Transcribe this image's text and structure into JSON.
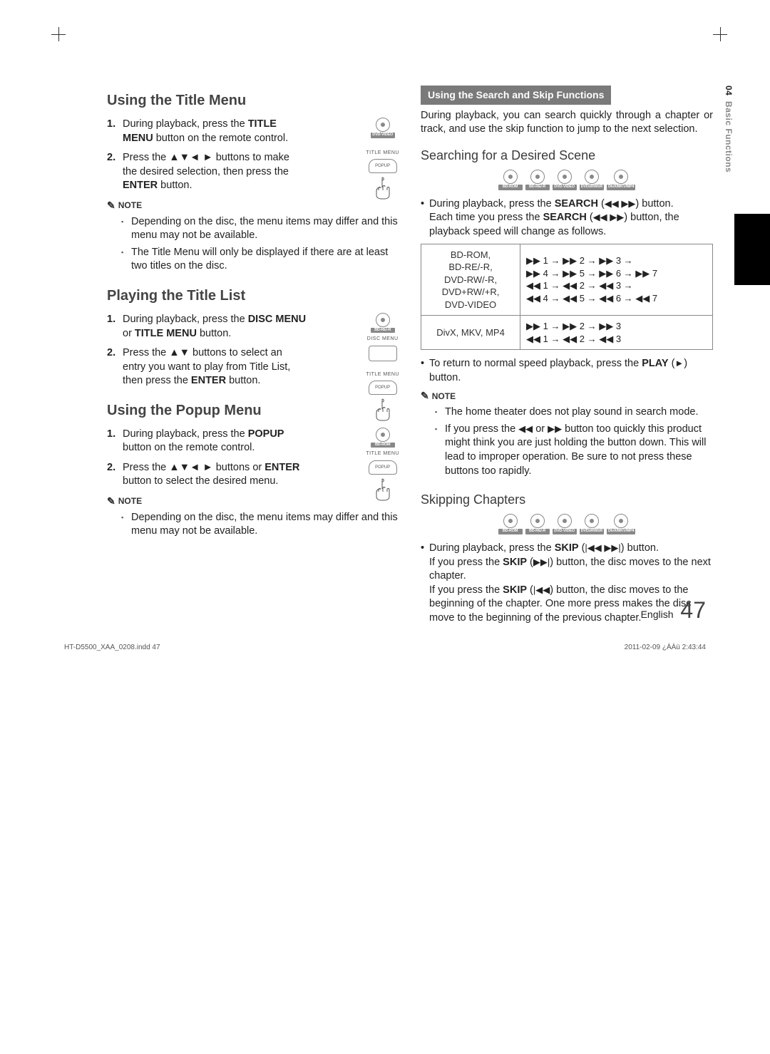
{
  "sideTab": {
    "chapter": "04",
    "label": "Basic Functions"
  },
  "left": {
    "s1": {
      "title": "Using the Title Menu",
      "badge": "DVD-VIDEO",
      "steps": [
        "During playback, press the <b>TITLE MENU</b> button on the remote control.",
        "Press the ▲▼◄ ► buttons to make the desired selection, then press the <b>ENTER</b> button."
      ],
      "noteLabel": "NOTE",
      "notes": [
        "Depending on the disc, the menu items may differ and this menu may not be available.",
        "The Title Menu will only be displayed if there are at least two titles on the disc."
      ],
      "btnLabels": {
        "title": "TITLE MENU",
        "popup": "POPUP"
      }
    },
    "s2": {
      "title": "Playing the Title List",
      "badge": "BD-RE/-R",
      "steps": [
        "During playback, press the <b>DISC MENU</b> or <b>TITLE MENU</b> button.",
        "Press the ▲▼ buttons to select an entry you want to play from Title List, then press the <b>ENTER</b> button."
      ],
      "btnLabels": {
        "disc": "DISC MENU",
        "title": "TITLE MENU",
        "popup": "POPUP"
      }
    },
    "s3": {
      "title": "Using the Popup Menu",
      "badge": "BD-ROM",
      "steps": [
        "During playback, press the <b>POPUP</b> button on the remote control.",
        "Press the ▲▼◄ ► buttons or <b>ENTER</b> button to select the desired menu."
      ],
      "noteLabel": "NOTE",
      "notes": [
        "Depending on the disc, the menu items may differ and this menu may not be available."
      ],
      "btnLabels": {
        "title": "TITLE MENU",
        "popup": "POPUP"
      }
    }
  },
  "right": {
    "band": "Using the Search and Skip Functions",
    "intro": "During playback, you can search quickly through a chapter or track, and use the skip function to jump to the next selection.",
    "search": {
      "title": "Searching for a Desired Scene",
      "badges": [
        "BD-ROM",
        "BD-RE/-R",
        "DVD-VIDEO",
        "DVD±RW/±R",
        "DivX/MKV/MP4"
      ],
      "bullet1a": "During playback, press the ",
      "bullet1b": " button.",
      "bullet1c": "Each time you press the ",
      "bullet1d": " button, the playback speed will change as follows.",
      "searchLabel": "SEARCH",
      "tableRow1Left": "BD-ROM,\nBD-RE/-R,\nDVD-RW/-R,\nDVD+RW/+R,\nDVD-VIDEO",
      "tableRow1Right": " 1 →  2 →  3 →\n 4 →  5 →  6 →  7\n 1 →  2 →  3 →\n 4 →  5 →  6 →  7",
      "tableRow2Left": "DivX, MKV, MP4",
      "tableRow2Right": " 1 →  2 →  3\n 1 →  2 →  3",
      "bullet2a": "To return to normal speed playback, press the ",
      "bullet2b": " button.",
      "playLabel": "PLAY",
      "noteLabel": "NOTE",
      "notes": [
        "The home theater does not play sound in search mode.",
        "If you press the  or  button too quickly this product might think you are just holding the button down. This will lead to improper operation. Be sure to not press these buttons too rapidly."
      ]
    },
    "skip": {
      "title": "Skipping Chapters",
      "badges": [
        "BD-ROM",
        "BD-RE/-R",
        "DVD-VIDEO",
        "DVD±RW/±R",
        "DivX/MKV/MP4"
      ],
      "bullet1a": "During playback, press the ",
      "bullet1b": " button.",
      "skipLabel": "SKIP",
      "p2": "If you press the <b>SKIP</b> (<span class='ico'>▶▶|</span>) button, the disc moves to the next chapter.",
      "p3": "If you press the <b>SKIP</b> (<span class='ico'>|◀◀</span>) button, the disc moves to the beginning of the chapter. One more press makes the disc move to the beginning of the previous chapter."
    }
  },
  "footer": {
    "lang": "English",
    "page": "47",
    "file": "HT-D5500_XAA_0208.indd   47",
    "stamp": "2011-02-09   ¿ÀÀü 2:43:44"
  }
}
